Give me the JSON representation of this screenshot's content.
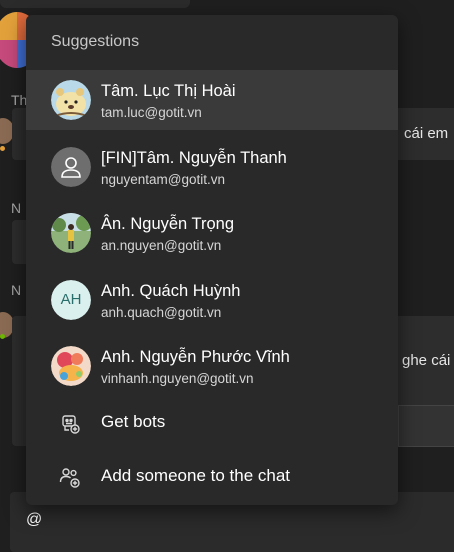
{
  "background": {
    "side_letters": [
      "Th",
      "N",
      "N"
    ],
    "snippet_1": "cái em",
    "snippet_2": "ghe cái",
    "compose_text": "@"
  },
  "popup": {
    "title": "Suggestions",
    "people": [
      {
        "name": "Tâm. Lục Thị Hoài",
        "email": "tam.luc@gotit.vn",
        "avatar": "cartoon-avatar"
      },
      {
        "name": "[FIN]Tâm. Nguyễn Thanh",
        "email": "nguyentam@gotit.vn",
        "avatar": "default-person-avatar"
      },
      {
        "name": "Ân. Nguyễn Trọng",
        "email": "an.nguyen@gotit.vn",
        "avatar": "photo-avatar"
      },
      {
        "name": "Anh. Quách Huỳnh",
        "email": "anh.quach@gotit.vn",
        "avatar": "initials-avatar",
        "initials": "AH"
      },
      {
        "name": "Anh. Nguyễn Phước Vĩnh",
        "email": "vinhanh.nguyen@gotit.vn",
        "avatar": "photo-avatar"
      }
    ],
    "actions": [
      {
        "label": "Get bots",
        "icon": "bot-add-icon"
      },
      {
        "label": "Add someone to the chat",
        "icon": "people-add-icon"
      }
    ]
  }
}
